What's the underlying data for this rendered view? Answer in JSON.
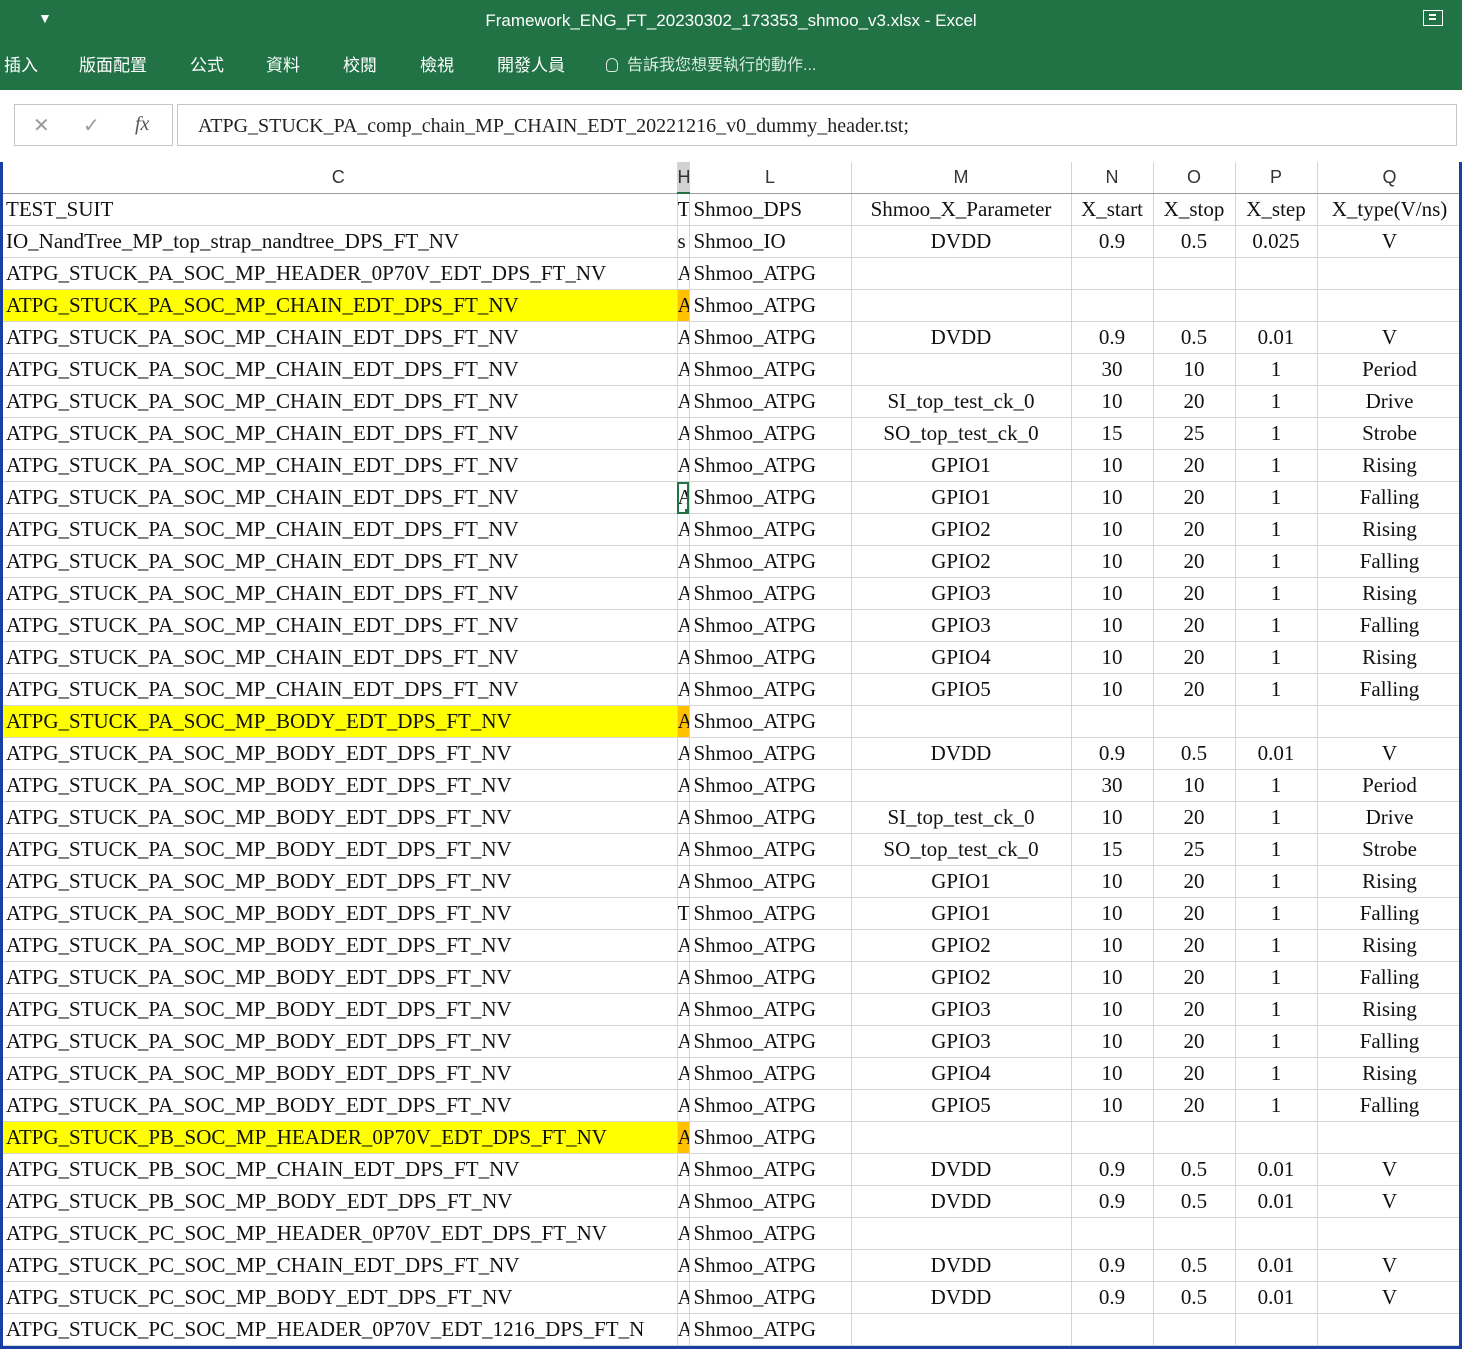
{
  "window": {
    "title": "Framework_ENG_FT_20230302_173353_shmoo_v3.xlsx - Excel",
    "qat_icon": "customize-quick-access-icon",
    "ribbon_display_icon": "ribbon-display-options-icon"
  },
  "ribbon": {
    "tabs": [
      "插入",
      "版面配置",
      "公式",
      "資料",
      "校閱",
      "檢視",
      "開發人員"
    ],
    "tell_me": "告訴我您想要執行的動作..."
  },
  "formula_bar": {
    "cancel": "✕",
    "enter": "✓",
    "fx": "fx",
    "value": "ATPG_STUCK_PA_comp_chain_MP_CHAIN_EDT_20221216_v0_dummy_header.tst;"
  },
  "colors": {
    "title_green": "#217346",
    "highlight_yellow": "#ffff00",
    "highlight_orange": "#ffc000",
    "frame_blue": "#1a3fa4"
  },
  "grid": {
    "columns": [
      "C",
      "H",
      "L",
      "M",
      "N",
      "O",
      "P",
      "Q"
    ],
    "rows": [
      [
        "TEST_SUIT",
        "T",
        "Shmoo_DPS",
        "Shmoo_X_Parameter",
        "X_start",
        "X_stop",
        "X_step",
        "X_type(V/ns)"
      ],
      [
        "IO_NandTree_MP_top_strap_nandtree_DPS_FT_NV",
        "s",
        "Shmoo_IO",
        "DVDD",
        "0.9",
        "0.5",
        "0.025",
        "V"
      ],
      [
        "ATPG_STUCK_PA_SOC_MP_HEADER_0P70V_EDT_DPS_FT_NV",
        "A",
        "Shmoo_ATPG",
        "",
        "",
        "",
        "",
        ""
      ],
      [
        "ATPG_STUCK_PA_SOC_MP_CHAIN_EDT_DPS_FT_NV",
        "A",
        "Shmoo_ATPG",
        "",
        "",
        "",
        "",
        ""
      ],
      [
        "ATPG_STUCK_PA_SOC_MP_CHAIN_EDT_DPS_FT_NV",
        "A",
        "Shmoo_ATPG",
        "DVDD",
        "0.9",
        "0.5",
        "0.01",
        "V"
      ],
      [
        "ATPG_STUCK_PA_SOC_MP_CHAIN_EDT_DPS_FT_NV",
        "A",
        "Shmoo_ATPG",
        "",
        "30",
        "10",
        "1",
        "Period"
      ],
      [
        "ATPG_STUCK_PA_SOC_MP_CHAIN_EDT_DPS_FT_NV",
        "A",
        "Shmoo_ATPG",
        "SI_top_test_ck_0",
        "10",
        "20",
        "1",
        "Drive"
      ],
      [
        "ATPG_STUCK_PA_SOC_MP_CHAIN_EDT_DPS_FT_NV",
        "A",
        "Shmoo_ATPG",
        "SO_top_test_ck_0",
        "15",
        "25",
        "1",
        "Strobe"
      ],
      [
        "ATPG_STUCK_PA_SOC_MP_CHAIN_EDT_DPS_FT_NV",
        "A",
        "Shmoo_ATPG",
        "GPIO1",
        "10",
        "20",
        "1",
        "Rising"
      ],
      [
        "ATPG_STUCK_PA_SOC_MP_CHAIN_EDT_DPS_FT_NV",
        "A",
        "Shmoo_ATPG",
        "GPIO1",
        "10",
        "20",
        "1",
        "Falling"
      ],
      [
        "ATPG_STUCK_PA_SOC_MP_CHAIN_EDT_DPS_FT_NV",
        "A",
        "Shmoo_ATPG",
        "GPIO2",
        "10",
        "20",
        "1",
        "Rising"
      ],
      [
        "ATPG_STUCK_PA_SOC_MP_CHAIN_EDT_DPS_FT_NV",
        "A",
        "Shmoo_ATPG",
        "GPIO2",
        "10",
        "20",
        "1",
        "Falling"
      ],
      [
        "ATPG_STUCK_PA_SOC_MP_CHAIN_EDT_DPS_FT_NV",
        "A",
        "Shmoo_ATPG",
        "GPIO3",
        "10",
        "20",
        "1",
        "Rising"
      ],
      [
        "ATPG_STUCK_PA_SOC_MP_CHAIN_EDT_DPS_FT_NV",
        "A",
        "Shmoo_ATPG",
        "GPIO3",
        "10",
        "20",
        "1",
        "Falling"
      ],
      [
        "ATPG_STUCK_PA_SOC_MP_CHAIN_EDT_DPS_FT_NV",
        "A",
        "Shmoo_ATPG",
        "GPIO4",
        "10",
        "20",
        "1",
        "Rising"
      ],
      [
        "ATPG_STUCK_PA_SOC_MP_CHAIN_EDT_DPS_FT_NV",
        "A",
        "Shmoo_ATPG",
        "GPIO5",
        "10",
        "20",
        "1",
        "Falling"
      ],
      [
        "ATPG_STUCK_PA_SOC_MP_BODY_EDT_DPS_FT_NV",
        "A",
        "Shmoo_ATPG",
        "",
        "",
        "",
        "",
        ""
      ],
      [
        "ATPG_STUCK_PA_SOC_MP_BODY_EDT_DPS_FT_NV",
        "A",
        "Shmoo_ATPG",
        "DVDD",
        "0.9",
        "0.5",
        "0.01",
        "V"
      ],
      [
        "ATPG_STUCK_PA_SOC_MP_BODY_EDT_DPS_FT_NV",
        "A",
        "Shmoo_ATPG",
        "",
        "30",
        "10",
        "1",
        "Period"
      ],
      [
        "ATPG_STUCK_PA_SOC_MP_BODY_EDT_DPS_FT_NV",
        "A",
        "Shmoo_ATPG",
        "SI_top_test_ck_0",
        "10",
        "20",
        "1",
        "Drive"
      ],
      [
        "ATPG_STUCK_PA_SOC_MP_BODY_EDT_DPS_FT_NV",
        "A",
        "Shmoo_ATPG",
        "SO_top_test_ck_0",
        "15",
        "25",
        "1",
        "Strobe"
      ],
      [
        "ATPG_STUCK_PA_SOC_MP_BODY_EDT_DPS_FT_NV",
        "A",
        "Shmoo_ATPG",
        "GPIO1",
        "10",
        "20",
        "1",
        "Rising"
      ],
      [
        "ATPG_STUCK_PA_SOC_MP_BODY_EDT_DPS_FT_NV",
        "T",
        "Shmoo_ATPG",
        "GPIO1",
        "10",
        "20",
        "1",
        "Falling"
      ],
      [
        "ATPG_STUCK_PA_SOC_MP_BODY_EDT_DPS_FT_NV",
        "A",
        "Shmoo_ATPG",
        "GPIO2",
        "10",
        "20",
        "1",
        "Rising"
      ],
      [
        "ATPG_STUCK_PA_SOC_MP_BODY_EDT_DPS_FT_NV",
        "A",
        "Shmoo_ATPG",
        "GPIO2",
        "10",
        "20",
        "1",
        "Falling"
      ],
      [
        "ATPG_STUCK_PA_SOC_MP_BODY_EDT_DPS_FT_NV",
        "A",
        "Shmoo_ATPG",
        "GPIO3",
        "10",
        "20",
        "1",
        "Rising"
      ],
      [
        "ATPG_STUCK_PA_SOC_MP_BODY_EDT_DPS_FT_NV",
        "A",
        "Shmoo_ATPG",
        "GPIO3",
        "10",
        "20",
        "1",
        "Falling"
      ],
      [
        "ATPG_STUCK_PA_SOC_MP_BODY_EDT_DPS_FT_NV",
        "A",
        "Shmoo_ATPG",
        "GPIO4",
        "10",
        "20",
        "1",
        "Rising"
      ],
      [
        "ATPG_STUCK_PA_SOC_MP_BODY_EDT_DPS_FT_NV",
        "A",
        "Shmoo_ATPG",
        "GPIO5",
        "10",
        "20",
        "1",
        "Falling"
      ],
      [
        "ATPG_STUCK_PB_SOC_MP_HEADER_0P70V_EDT_DPS_FT_NV",
        "A",
        "Shmoo_ATPG",
        "",
        "",
        "",
        "",
        ""
      ],
      [
        "ATPG_STUCK_PB_SOC_MP_CHAIN_EDT_DPS_FT_NV",
        "A",
        "Shmoo_ATPG",
        "DVDD",
        "0.9",
        "0.5",
        "0.01",
        "V"
      ],
      [
        "ATPG_STUCK_PB_SOC_MP_BODY_EDT_DPS_FT_NV",
        "A",
        "Shmoo_ATPG",
        "DVDD",
        "0.9",
        "0.5",
        "0.01",
        "V"
      ],
      [
        "ATPG_STUCK_PC_SOC_MP_HEADER_0P70V_EDT_DPS_FT_NV",
        "A",
        "Shmoo_ATPG",
        "",
        "",
        "",
        "",
        ""
      ],
      [
        "ATPG_STUCK_PC_SOC_MP_CHAIN_EDT_DPS_FT_NV",
        "A",
        "Shmoo_ATPG",
        "DVDD",
        "0.9",
        "0.5",
        "0.01",
        "V"
      ],
      [
        "ATPG_STUCK_PC_SOC_MP_BODY_EDT_DPS_FT_NV",
        "A",
        "Shmoo_ATPG",
        "DVDD",
        "0.9",
        "0.5",
        "0.01",
        "V"
      ],
      [
        "ATPG_STUCK_PC_SOC_MP_HEADER_0P70V_EDT_1216_DPS_FT_N",
        "A",
        "Shmoo_ATPG",
        "",
        "",
        "",
        "",
        ""
      ]
    ],
    "highlighted_rows": [
      3,
      16,
      29
    ],
    "active_cell": {
      "row": 9,
      "col": 1
    }
  }
}
